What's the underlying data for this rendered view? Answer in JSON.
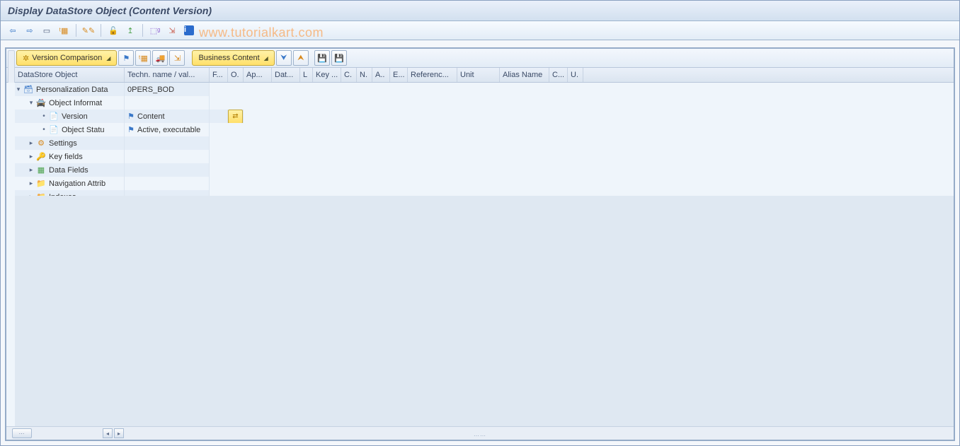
{
  "title": "Display DataStore Object (Content Version)",
  "watermark": "www.tutorialkart.com",
  "app_toolbar": {
    "back": "⇦",
    "forward": "⇨",
    "display": "▭",
    "tree": "⇶",
    "tools": "✎✎",
    "lock": "🔒",
    "up": "↥",
    "graph": "⬚",
    "results": "⇲",
    "info": "ℹ"
  },
  "inner_toolbar": {
    "version_comparison": "Version Comparison",
    "business_content": "Business Content"
  },
  "columns": {
    "tree": "DataStore Object",
    "tech": "Techn. name / val...",
    "f": "F...",
    "o": "O.",
    "app": "Ap...",
    "dat": "Dat...",
    "l": "L",
    "key": "Key ...",
    "c": "C.",
    "n": "N.",
    "a": "A..",
    "e": "E...",
    "ref": "Referenc...",
    "unit": "Unit",
    "alias": "Alias Name",
    "c2": "C...",
    "u": "U."
  },
  "tree": {
    "root": {
      "label": "Personalization Data",
      "tech": "0PERS_BOD"
    },
    "object_info": {
      "label": "Object Informat"
    },
    "version": {
      "label": "Version",
      "value": "Content"
    },
    "object_status": {
      "label": "Object Statu",
      "value": "Active, executable"
    },
    "settings": {
      "label": "Settings"
    },
    "key_fields": {
      "label": "Key fields"
    },
    "data_fields": {
      "label": "Data Fields"
    },
    "nav_attr": {
      "label": "Navigation Attrib"
    },
    "indexes": {
      "label": "Indexes"
    }
  }
}
